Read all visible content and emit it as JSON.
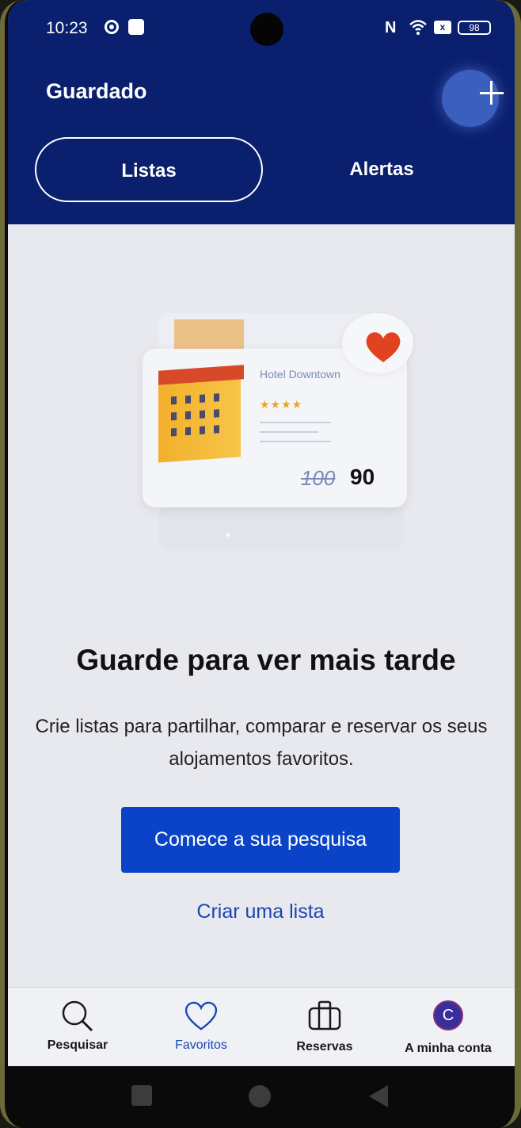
{
  "status_bar": {
    "time": "10:23",
    "nfc": "N",
    "battery": "98"
  },
  "header": {
    "title": "Guardado",
    "add_icon": "plus-icon",
    "tabs": [
      {
        "label": "Listas",
        "active": true
      },
      {
        "label": "Alertas",
        "active": false
      }
    ]
  },
  "illustration": {
    "hotel_name": "Hotel Downtown",
    "stars": "★★★★",
    "old_price": "100",
    "new_price": "90",
    "heart_color": "#e1421f"
  },
  "empty_state": {
    "headline": "Guarde para ver mais tarde",
    "description": "Crie listas para partilhar, comparar e reservar os seus alojamentos favoritos.",
    "primary_button": "Comece a sua pesquisa",
    "secondary_link": "Criar uma lista"
  },
  "bottom_nav": {
    "items": [
      {
        "label": "Pesquisar",
        "icon": "search-icon",
        "active": false
      },
      {
        "label": "Favoritos",
        "icon": "heart-icon",
        "active": true
      },
      {
        "label": "Reservas",
        "icon": "briefcase-icon",
        "active": false
      },
      {
        "label": "A minha conta",
        "icon": "avatar",
        "active": false
      }
    ],
    "avatar_initial": "C",
    "active_color": "#1a45b8"
  },
  "colors": {
    "header_bg": "#0a1f6d",
    "primary": "#0a43c7"
  }
}
